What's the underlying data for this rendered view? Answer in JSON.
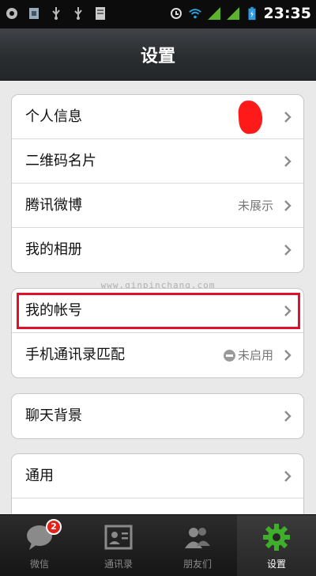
{
  "status_bar": {
    "time": "23:35",
    "icons": [
      "app-icon",
      "sim-icon",
      "usb-icon",
      "usb-icon",
      "storage-icon",
      "sync-icon",
      "wifi-icon",
      "signal-icon",
      "signal-icon",
      "battery-icon"
    ]
  },
  "header": {
    "title": "设置"
  },
  "groups": [
    {
      "items": [
        {
          "label": "个人信息",
          "value": ""
        },
        {
          "label": "二维码名片",
          "value": ""
        },
        {
          "label": "腾讯微博",
          "value": "未展示"
        },
        {
          "label": "我的相册",
          "value": ""
        }
      ]
    },
    {
      "items": [
        {
          "label": "我的帐号",
          "value": ""
        },
        {
          "label": "手机通讯录匹配",
          "value": "未启用"
        }
      ]
    },
    {
      "items": [
        {
          "label": "聊天背景",
          "value": ""
        }
      ]
    },
    {
      "items": [
        {
          "label": "通用",
          "value": ""
        }
      ]
    }
  ],
  "watermark": "www.qinpinchang.com",
  "tabs": [
    {
      "label": "微信",
      "badge": "2"
    },
    {
      "label": "通讯录"
    },
    {
      "label": "朋友们"
    },
    {
      "label": "设置"
    }
  ],
  "colors": {
    "accent_highlight": "#e0102a",
    "active_tab_icon": "#3fae2a",
    "badge": "#e2231a"
  }
}
